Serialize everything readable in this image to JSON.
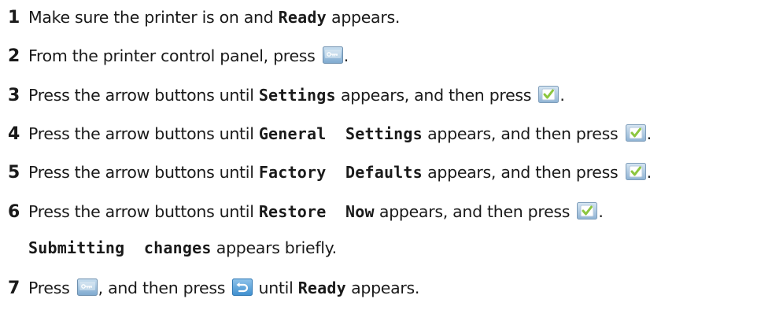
{
  "steps": [
    {
      "num": "1",
      "t1": "Make sure the printer is on and ",
      "c1": "Ready",
      "t2": " appears."
    },
    {
      "num": "2",
      "t1": "From the printer control panel, press ",
      "t2": "."
    },
    {
      "num": "3",
      "t1": "Press the arrow buttons until ",
      "c1": "Settings",
      "t2": " appears, and then press ",
      "t3": "."
    },
    {
      "num": "4",
      "t1": "Press the arrow buttons until ",
      "c1": "General  Settings",
      "t2": " appears, and then press ",
      "t3": "."
    },
    {
      "num": "5",
      "t1": "Press the arrow buttons until ",
      "c1": "Factory  Defaults",
      "t2": " appears, and then press ",
      "t3": "."
    },
    {
      "num": "6",
      "t1": "Press the arrow buttons until ",
      "c1": "Restore  Now",
      "t2": " appears, and then press ",
      "t3": "."
    },
    {
      "c1": "Submitting  changes",
      "t1": " appears briefly."
    },
    {
      "num": "7",
      "t1": "Press ",
      "t2": ", and then press ",
      "t3": " until ",
      "c1": "Ready",
      "t4": " appears."
    }
  ],
  "icons": {
    "menu": "menu-key-icon",
    "select": "select-check-icon",
    "back": "back-arrow-icon"
  }
}
